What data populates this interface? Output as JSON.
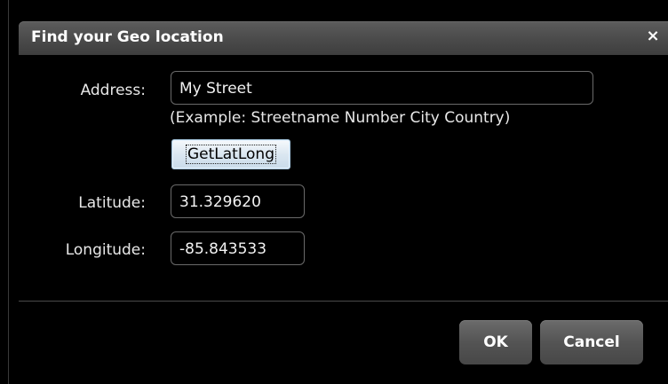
{
  "dialog": {
    "title": "Find your Geo location",
    "close_glyph": "×",
    "close_icon": "close-icon"
  },
  "form": {
    "address_label": "Address:",
    "address_value": "My Street",
    "address_hint": "(Example: Streetname Number City Country)",
    "get_button_label": "GetLatLong",
    "latitude_label": "Latitude:",
    "latitude_value": "31.329620",
    "longitude_label": "Longitude:",
    "longitude_value": "-85.843533"
  },
  "footer": {
    "ok_label": "OK",
    "cancel_label": "Cancel"
  }
}
